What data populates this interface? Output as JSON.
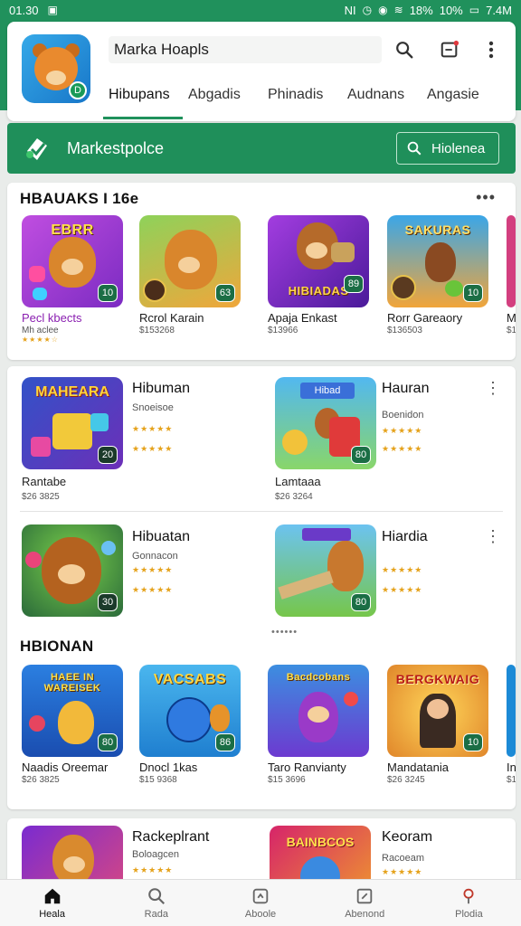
{
  "status_bar": {
    "time": "01.30",
    "right_text": "NI",
    "battery": "18%",
    "signal": "10%",
    "clock": "7.4M"
  },
  "header": {
    "search_text": "Marka Hoapls",
    "app_badge": "D",
    "tabs": [
      {
        "label": "Hibupans",
        "active": true
      },
      {
        "label": "Abgadis",
        "active": false
      },
      {
        "label": "Phinadis",
        "active": false
      },
      {
        "label": "Audnans",
        "active": false
      },
      {
        "label": "Angasie",
        "active": false
      }
    ]
  },
  "marketplace": {
    "title": "Markestpolce",
    "search_label": "Hiolenea"
  },
  "section1": {
    "title": "HBAUAKS I 16e",
    "more": "•••",
    "tiles": [
      {
        "thumb_text": "EBRR",
        "name": "Pecl kbects",
        "sub": "Mh aclee",
        "stars": "★★★★☆",
        "corner": "10",
        "accent": "#b443d6"
      },
      {
        "thumb_text": "",
        "name": "Rcrol Karain",
        "sub": "$153268",
        "stars": "",
        "corner": "63",
        "accent": "#2f9e3d"
      },
      {
        "thumb_text": "HIBIADAS",
        "name": "Apaja Enkast",
        "sub": "$13966",
        "stars": "",
        "corner": "89",
        "accent": "#8a3bd1"
      },
      {
        "thumb_text": "SAKURAS",
        "name": "Rorr Gareaory",
        "sub": "$136503",
        "stars": "",
        "corner": "10",
        "accent": "#2e8fd8"
      },
      {
        "thumb_text": "",
        "name": "M",
        "sub": "$1",
        "stars": "",
        "corner": "",
        "accent": "#d33f7f"
      }
    ]
  },
  "section2": {
    "rows": [
      {
        "left": {
          "thumb_text": "MAHEARA",
          "title": "Hibuman",
          "sub": "Snoeisoe",
          "stars": "★★★★★",
          "stars2": "★★★★★",
          "corner": "20",
          "caption": "Rantabe",
          "caption_sub": "$26 3825"
        },
        "right": {
          "thumb_text": "Hibad",
          "title": "Hauran",
          "sub": "Boenidon",
          "stars": "★★★★★",
          "stars2": "★★★★★",
          "corner": "80",
          "caption": "Lamtaaa",
          "caption_sub": "$26 3264"
        }
      },
      {
        "left": {
          "thumb_text": "",
          "title": "Hibuatan",
          "sub": "Gonnacon",
          "stars": "★★★★★",
          "stars2": "★★★★★",
          "corner": "30",
          "caption": "",
          "caption_sub": ""
        },
        "right": {
          "thumb_text": "",
          "title": "Hiardia",
          "sub": "",
          "stars": "★★★★★",
          "stars2": "★★★★★",
          "corner": "80",
          "caption": "",
          "caption_sub": ""
        }
      }
    ],
    "dots": "••••••",
    "subsection_title": "HBIONAN",
    "tiles": [
      {
        "thumb_text": "HAEE IN WAREISEK",
        "name": "Naadis Oreemar",
        "sub": "$26 3825",
        "corner": "80",
        "accent": "#2b7fe0"
      },
      {
        "thumb_text": "VACSABS",
        "name": "Dnocl 1kas",
        "sub": "$15 9368",
        "corner": "86",
        "accent": "#2aa4e0"
      },
      {
        "thumb_text": "Bacdcobans",
        "name": "Taro Ranvianty",
        "sub": "$15 3696",
        "corner": "",
        "accent": "#7a3bd6"
      },
      {
        "thumb_text": "BERGKWAIG",
        "name": "Mandatania",
        "sub": "$26 3245",
        "corner": "10",
        "accent": "#e39b28"
      },
      {
        "thumb_text": "",
        "name": "In",
        "sub": "$1",
        "corner": "",
        "accent": "#1c8ad6"
      }
    ]
  },
  "section3": {
    "left": {
      "thumb_text": "",
      "title": "Rackeplrant",
      "sub": "Boloagcen",
      "stars": "★★★★★"
    },
    "right": {
      "thumb_text": "BAINBCOS",
      "title": "Keoram",
      "sub": "Racoeam",
      "stars": "★★★★★"
    }
  },
  "bottom_nav": [
    {
      "label": "Heala",
      "icon": "home-icon",
      "active": true
    },
    {
      "label": "Rada",
      "icon": "search-icon",
      "active": false
    },
    {
      "label": "Aboole",
      "icon": "apps-icon",
      "active": false
    },
    {
      "label": "Abenond",
      "icon": "edit-icon",
      "active": false
    },
    {
      "label": "Plodia",
      "icon": "profile-icon",
      "active": false
    }
  ],
  "colors": {
    "brand_green": "#20915c",
    "star": "#e5a21b"
  }
}
